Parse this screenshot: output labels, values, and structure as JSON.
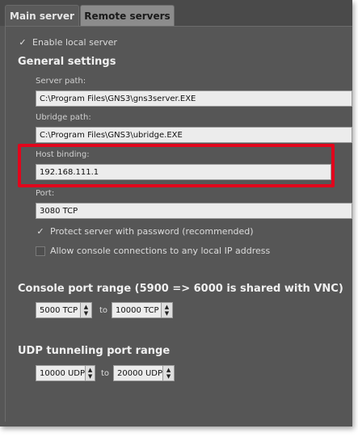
{
  "tabs": [
    {
      "label": "Main server",
      "active": true
    },
    {
      "label": "Remote servers",
      "active": false
    }
  ],
  "enable_local_server": {
    "label": "Enable local server",
    "checked": true
  },
  "general_settings": {
    "heading": "General settings",
    "server_path": {
      "label": "Server path:",
      "value": "C:\\Program Files\\GNS3\\gns3server.EXE"
    },
    "ubridge_path": {
      "label": "Ubridge path:",
      "value": "C:\\Program Files\\GNS3\\ubridge.EXE"
    },
    "host_binding": {
      "label": "Host binding:",
      "value": "192.168.111.1"
    },
    "port": {
      "label": "Port:",
      "value": "3080 TCP"
    },
    "protect_password": {
      "label": "Protect server with password (recommended)",
      "checked": true
    },
    "allow_console": {
      "label": "Allow console connections to any local IP address",
      "checked": false
    }
  },
  "console_port_range": {
    "heading": "Console port range (5900 => 6000 is shared with VNC)",
    "start": "5000 TCP",
    "to": "to",
    "end": "10000 TCP"
  },
  "udp_tunneling": {
    "heading": "UDP tunneling port range",
    "start": "10000 UDP",
    "to": "to",
    "end": "20000 UDP"
  },
  "colors": {
    "panel_bg": "#565656",
    "highlight_border": "#e1061c",
    "field_bg": "#ececec"
  },
  "icons": {
    "checkmark": "checkmark-icon",
    "spin_up": "arrow-up-icon",
    "spin_down": "arrow-down-icon"
  }
}
